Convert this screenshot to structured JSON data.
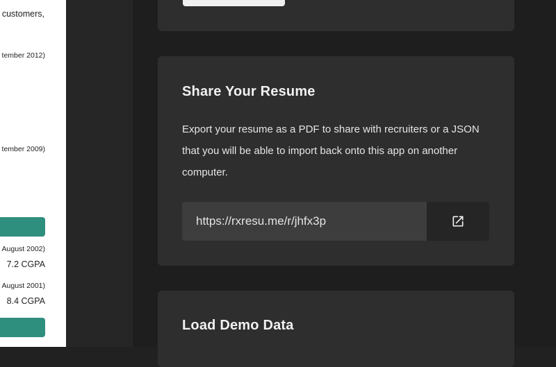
{
  "preview": {
    "line1": "customers,",
    "date1": "tember 2012)",
    "date2": "tember 2009)",
    "edu1_date": "August 2002)",
    "edu1_grade": "7.2 CGPA",
    "edu2_date": "August 2001)",
    "edu2_grade": "8.4 CGPA",
    "accent": "#2f8f7f"
  },
  "share_card": {
    "title": "Share Your Resume",
    "description": "Export your resume as a PDF to share with recruiters or a JSON that you will be able to import back onto this app on another computer.",
    "share_url": "https://rxresu.me/r/jhfx3p",
    "open_icon": "open-in-new-icon"
  },
  "demo_card": {
    "title": "Load Demo Data"
  }
}
